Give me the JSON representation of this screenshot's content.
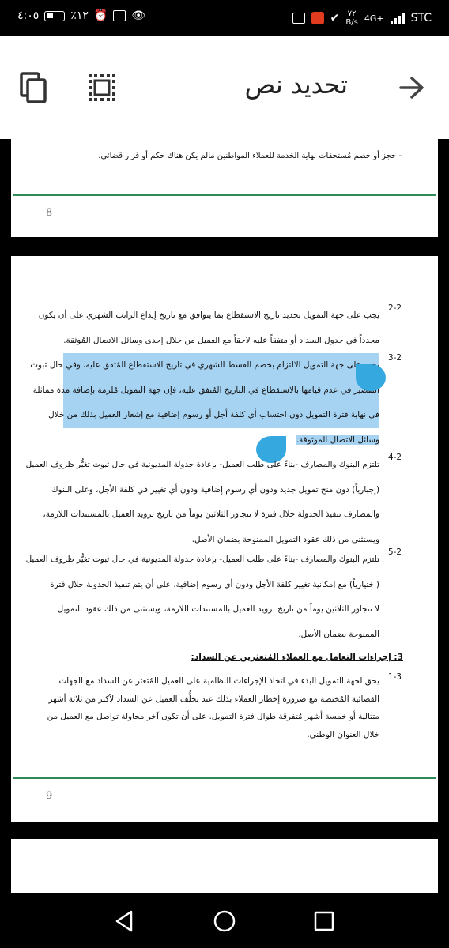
{
  "status_bar": {
    "time": "٤:٠٥",
    "battery_percent": "٪١٢",
    "network_speed_value": "٧٢",
    "network_speed_unit": "B/s",
    "network_type": "4G+",
    "carrier": "STC"
  },
  "header": {
    "title": "تحديد نص",
    "icons": [
      "copy-icon",
      "select-all-icon",
      "back-arrow-icon"
    ]
  },
  "page8": {
    "top_text": "-   حجز أو خصم مُستحقات نهاية الخدمة للعملاء المواطنين مالم يكن هناك حكم أو قرار قضائي.",
    "page_number": "8"
  },
  "page9": {
    "items": [
      {
        "number": "2-2",
        "lines": [
          "يجب على جهة التمويل تحديد تاريخ الاستقطاع بما يتوافق مع تاريخ إيداع الراتب الشهري على أن يكون",
          "محدداً في جدول السداد أو متفقاً عليه لاحقاً مع العميل من خلال إحدى وسائل الاتصال المُوثقة."
        ]
      },
      {
        "number": "3-2",
        "lines": [
          "يجب على جهة التمويل الالتزام بخصم القسط الشهري في تاريخ الاستقطاع المُتفق عليه، وفي حال ثبوت",
          "التقصير في عدم قيامها بالاستقطاع في التاريخ المُتفق عليه، فإن جهة التمويل مُلزمة بإضافة مدة مماثلة",
          "في نهاية فترة التمويل دون احتساب أي كلفة أجل أو رسوم إضافية مع إشعار العميل بذلك من خلال",
          "وسائل الاتصال الموثوقة."
        ]
      },
      {
        "number": "4-2",
        "lines": [
          "تلتزم البنوك والمصارف -بناءً على طلب العميل- بإعادة جدولة المديونية في حال ثبوت تغيُّر ظروف العميل",
          "(إجبارياً) دون منح تمويل جديد ودون أي رسوم إضافية ودون أي تغيير في كلفة الأجل، وعلى البنوك",
          "والمصارف تنفيذ الجدولة خلال فترة لا تتجاوز الثلاثين يوماً من تاريخ تزويد العميل بالمستندات اللازمة،",
          "ويستثنى من ذلك عقود التمويل الممنوحة بضمان الأصل."
        ]
      },
      {
        "number": "5-2",
        "lines": [
          "تلتزم البنوك والمصارف -بناءً على طلب العميل- بإعادة جدولة المديونية في حال ثبوت تغيُّر ظروف العميل",
          "(اختيارياً) مع إمكانية تغيير كلفة الأجل ودون أي رسوم إضافية، على أن يتم تنفيذ الجدولة خلال فترة",
          "لا تتجاوز الثلاثين يوماً من تاريخ تزويد العميل بالمستندات اللازمة، ويستثنى من ذلك عقود التمويل",
          "الممنوحة بضمان الأصل."
        ]
      }
    ],
    "section_title": "3: إجراءات التعامل مع العملاء المُتعثرين عن السداد:",
    "item_31": {
      "number": "1-3",
      "lines": [
        "يحق لجهة التمويل البدء في اتخاذ الإجراءات النظامية على العميل المُتعثر عن السداد مع الجهات",
        "القضائية المُختصة مع ضرورة إخطار العملاء بذلك عند تخلُّف العميل عن السداد لأكثر من ثلاثة أشهر",
        "متتالية أو خمسة أشهر مُتفرقة طوال فترة التمويل. على أن تكون آخر محاولة تواصل مع العميل من",
        "خلال العنوان الوطني."
      ]
    },
    "page_number": "9"
  },
  "colors": {
    "selection": "#a7d3f3",
    "selection_handle": "#35a8df",
    "rule_green": "#2e8b57"
  },
  "nav_bar": {
    "icons": [
      "back-triangle-icon",
      "home-circle-icon",
      "recents-square-icon"
    ]
  }
}
